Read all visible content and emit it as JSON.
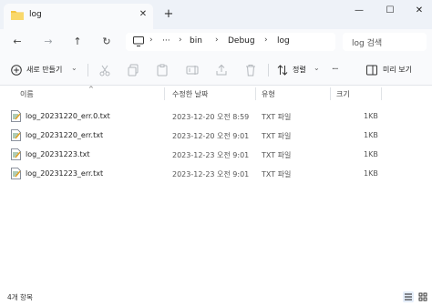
{
  "window": {
    "tab_title": "log",
    "tab_close_icon": "close-icon",
    "new_tab_icon": "plus-icon",
    "minimize_glyph": "—",
    "maximize_glyph": "☐",
    "close_glyph": "✕",
    "plus_glyph": "+",
    "tab_close_glyph": "✕"
  },
  "nav": {
    "back_glyph": "←",
    "forward_glyph": "→",
    "up_glyph": "↑",
    "refresh_glyph": "↻",
    "more_crumbs": "···",
    "separator": "›",
    "breadcrumbs": [
      "bin",
      "Debug",
      "log"
    ],
    "search_placeholder": "log 검색"
  },
  "toolbar": {
    "new_label": "새로 만들기",
    "new_chevron": "⌄",
    "sort_label": "정렬",
    "sort_chevron": "⌄",
    "more_glyph": "···",
    "preview_label": "미리 보기"
  },
  "columns": {
    "name": "이름",
    "modified": "수정한 날짜",
    "type": "유형",
    "size": "크기",
    "sort_glyph": "^"
  },
  "files": [
    {
      "name": "log_20231220_err.0.txt",
      "modified": "2023-12-20 오전 8:59",
      "type": "TXT 파일",
      "size": "1KB"
    },
    {
      "name": "log_20231220_err.txt",
      "modified": "2023-12-20 오전 9:01",
      "type": "TXT 파일",
      "size": "1KB"
    },
    {
      "name": "log_20231223.txt",
      "modified": "2023-12-23 오전 9:01",
      "type": "TXT 파일",
      "size": "1KB"
    },
    {
      "name": "log_20231223_err.txt",
      "modified": "2023-12-23 오전 9:01",
      "type": "TXT 파일",
      "size": "1KB"
    }
  ],
  "status": {
    "item_count": "4개 항목"
  },
  "colors": {
    "accent": "#0067c0",
    "folder": "#f4c542"
  }
}
